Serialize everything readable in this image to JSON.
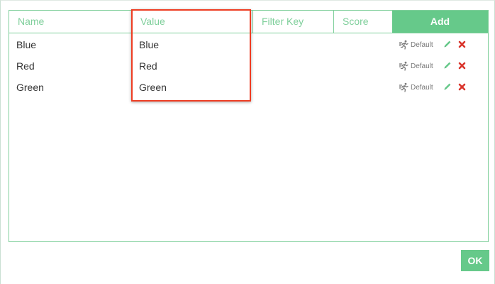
{
  "table": {
    "columns": [
      "Name",
      "Value",
      "Filter Key",
      "Score"
    ],
    "add_label": "Add",
    "rows": [
      {
        "name": "Blue",
        "value": "Blue",
        "default_label": "Default"
      },
      {
        "name": "Red",
        "value": "Red",
        "default_label": "Default"
      },
      {
        "name": "Green",
        "value": "Green",
        "default_label": "Default"
      }
    ]
  },
  "footer": {
    "ok_label": "OK"
  },
  "colors": {
    "accent": "#66c98a",
    "border": "#7fcf9b",
    "delete": "#d9342b",
    "highlight": "#ee3d23"
  },
  "icons": {
    "default": "running-person-icon",
    "edit": "pencil-icon",
    "delete": "close-icon"
  }
}
